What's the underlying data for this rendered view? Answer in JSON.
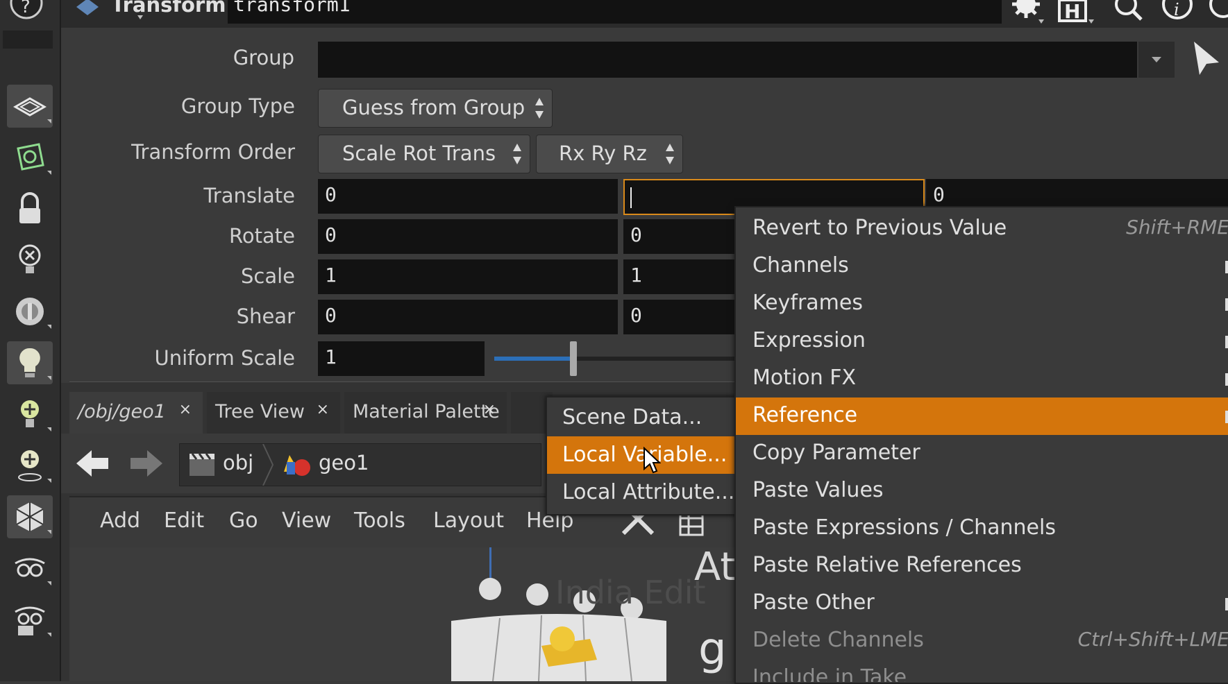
{
  "header": {
    "node_type": "Transform",
    "node_name": "transform1"
  },
  "params": {
    "group_label": "Group",
    "group_value": "",
    "group_type_label": "Group Type",
    "group_type_value": "Guess from Group",
    "transform_order_label": "Transform Order",
    "transform_order_value": "Scale Rot Trans",
    "rotate_order_value": "Rx Ry Rz",
    "translate_label": "Translate",
    "translate": [
      "0",
      "",
      "0"
    ],
    "rotate_label": "Rotate",
    "rotate": [
      "0",
      "0"
    ],
    "scale_label": "Scale",
    "scale": [
      "1",
      "1"
    ],
    "shear_label": "Shear",
    "shear": [
      "0",
      "0"
    ],
    "uniform_scale_label": "Uniform Scale",
    "uniform_scale_value": "1",
    "uniform_scale_slider_fraction": 0.33
  },
  "tabs": [
    {
      "label": "/obj/geo1"
    },
    {
      "label": "Tree View"
    },
    {
      "label": "Material Palette"
    }
  ],
  "path": {
    "items": [
      "obj",
      "geo1"
    ]
  },
  "network_menu": [
    "Add",
    "Edit",
    "Go",
    "View",
    "Tools",
    "Layout",
    "Help"
  ],
  "network_view": {
    "watermark": "India Edit",
    "partial_text_1": "At",
    "partial_text_2": "g"
  },
  "context_menu": {
    "items": [
      {
        "label": "Revert to Previous Value",
        "shortcut": "Shift+RME"
      },
      {
        "label": "Channels",
        "shortcut": ""
      },
      {
        "label": "Keyframes",
        "shortcut": ""
      },
      {
        "label": "Expression",
        "shortcut": ""
      },
      {
        "label": "Motion FX",
        "shortcut": ""
      },
      {
        "label": "Reference",
        "shortcut": ""
      },
      {
        "label": "Copy Parameter",
        "shortcut": ""
      },
      {
        "label": "Paste Values",
        "shortcut": ""
      },
      {
        "label": "Paste Expressions / Channels",
        "shortcut": ""
      },
      {
        "label": "Paste Relative References",
        "shortcut": ""
      },
      {
        "label": "Paste Other",
        "shortcut": ""
      },
      {
        "label": "Delete Channels",
        "shortcut": "Ctrl+Shift+LME"
      },
      {
        "label": "Include in Take",
        "shortcut": ""
      }
    ],
    "highlighted": "Reference"
  },
  "reference_submenu": {
    "items": [
      {
        "label": "Scene Data..."
      },
      {
        "label": "Local Variable..."
      },
      {
        "label": "Local Attribute..."
      }
    ],
    "highlighted": "Local Variable..."
  },
  "colors": {
    "highlight": "#d4750c",
    "field_bg": "#121212",
    "panel_bg": "#3a3a3a",
    "slider_blue": "#2c6fb8"
  }
}
